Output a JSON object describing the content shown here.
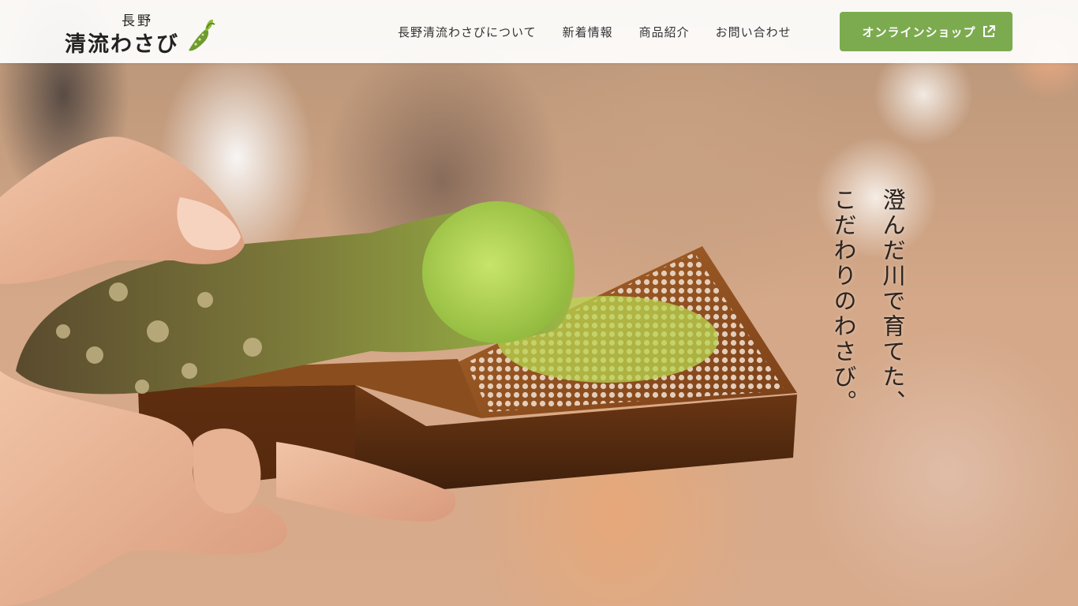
{
  "brand": {
    "logo_small": "長野",
    "logo_large": "清流わさび",
    "logo_mark_icon": "wasabi-root-icon"
  },
  "nav": {
    "items": [
      {
        "label": "長野清流わさびについて"
      },
      {
        "label": "新着情報"
      },
      {
        "label": "商品紹介"
      },
      {
        "label": "お問い合わせ"
      }
    ],
    "shop_button": {
      "label": "オンラインショップ",
      "icon": "external-link-icon",
      "color": "#7cab4f"
    }
  },
  "hero": {
    "image": "wasabi-grating-photo",
    "catch_lines": [
      "澄んだ川で育てた、",
      "こだわりのわさび。"
    ]
  }
}
